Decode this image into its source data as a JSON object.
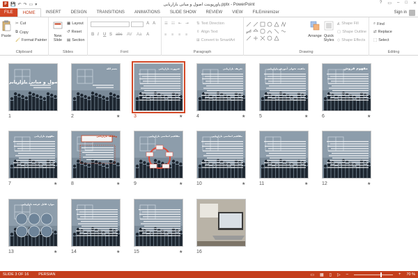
{
  "app": {
    "title": "پاورپوینت اصول و مبانی بازاریابی.pptx - PowerPoint",
    "logo": "P",
    "win_controls": [
      "?",
      "▭",
      "–",
      "□",
      "✕"
    ]
  },
  "qat": [
    "💾",
    "↶",
    "↷",
    "▭",
    "▾"
  ],
  "tabs": [
    {
      "label": "FILE",
      "kind": "file"
    },
    {
      "label": "HOME",
      "kind": "active"
    },
    {
      "label": "INSERT"
    },
    {
      "label": "DESIGN"
    },
    {
      "label": "TRANSITIONS"
    },
    {
      "label": "ANIMATIONS"
    },
    {
      "label": "SLIDE SHOW"
    },
    {
      "label": "REVIEW"
    },
    {
      "label": "VIEW"
    },
    {
      "label": "FILEminimizer"
    }
  ],
  "signin": "Sign in",
  "ribbon": {
    "clipboard": {
      "label": "Clipboard",
      "paste": "Paste",
      "cut": "Cut",
      "copy": "Copy",
      "format_painter": "Format Painter"
    },
    "slides": {
      "label": "Slides",
      "new_slide": "New Slide",
      "layout": "Layout",
      "reset": "Reset",
      "section": "Section"
    },
    "font": {
      "label": "Font",
      "bold": "B",
      "italic": "I",
      "underline": "U",
      "shadow": "S",
      "strike": "abc",
      "spacing": "AV",
      "case": "Aa",
      "color": "A"
    },
    "paragraph": {
      "label": "Paragraph",
      "text_direction": "Text Direction",
      "align_text": "Align Text",
      "smartart": "Convert to SmartArt"
    },
    "drawing": {
      "label": "Drawing",
      "arrange": "Arrange",
      "quick_styles": "Quick Styles",
      "shape_fill": "Shape Fill",
      "shape_outline": "Shape Outline",
      "shape_effects": "Shape Effects"
    },
    "editing": {
      "label": "Editing",
      "find": "Find",
      "replace": "Replace",
      "select": "Select"
    }
  },
  "slides": [
    {
      "num": "1",
      "title": "اصول و مبانی بازاریابی",
      "kind": "title",
      "star": false,
      "selected": false
    },
    {
      "num": "2",
      "title": "بسم الله",
      "kind": "title2",
      "star": true,
      "selected": false
    },
    {
      "num": "3",
      "title": "ضرورت بازاریابی",
      "kind": "text",
      "star": true,
      "selected": true
    },
    {
      "num": "4",
      "title": "تعریف بازاریابی",
      "kind": "text",
      "star": true,
      "selected": false
    },
    {
      "num": "5",
      "title": "ماهیت تحولی آموزش بازاریابی",
      "kind": "text",
      "star": true,
      "selected": false
    },
    {
      "num": "6",
      "title": "مفهوم فروش",
      "kind": "textbig",
      "star": true,
      "selected": false
    },
    {
      "num": "7",
      "title": "مفهوم بازاریابی",
      "kind": "text",
      "star": true,
      "selected": false
    },
    {
      "num": "8",
      "title": "وظایف بازاریابی",
      "kind": "boxed",
      "star": true,
      "selected": false
    },
    {
      "num": "9",
      "title": "مفاهیم اساسی بازاریابی",
      "kind": "cycle",
      "star": true,
      "selected": false
    },
    {
      "num": "10",
      "title": "مفاهیم اساسی بازاریابی",
      "kind": "text",
      "star": true,
      "selected": false
    },
    {
      "num": "11",
      "title": "",
      "kind": "text",
      "star": true,
      "selected": false
    },
    {
      "num": "12",
      "title": "",
      "kind": "text",
      "star": true,
      "selected": false
    },
    {
      "num": "13",
      "title": "موارد قابل عرضه بازاریابی",
      "kind": "circles",
      "star": true,
      "selected": false
    },
    {
      "num": "14",
      "title": "",
      "kind": "text",
      "star": true,
      "selected": false
    },
    {
      "num": "15",
      "title": "",
      "kind": "text",
      "star": true,
      "selected": false
    },
    {
      "num": "16",
      "title": "",
      "kind": "photo",
      "star": false,
      "selected": false
    }
  ],
  "status": {
    "slide_of": "SLIDE 3 OF 16",
    "language": "PERSIAN",
    "zoom": "70 %",
    "zoom_level": 0.7
  },
  "colors": {
    "accent": "#c43e1c",
    "file_tab": "#d24726",
    "status_bar": "#c43e1c"
  }
}
